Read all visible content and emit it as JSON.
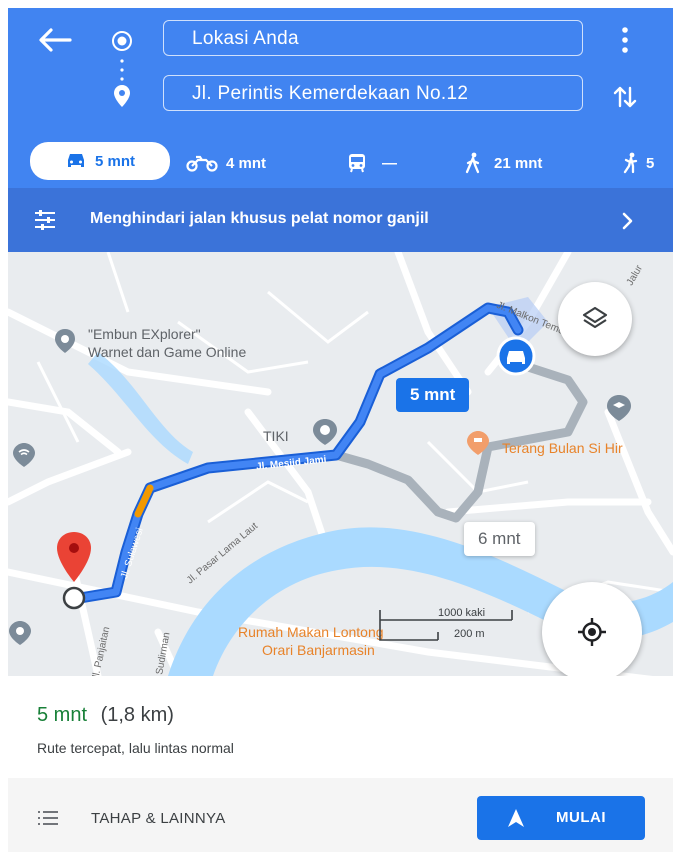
{
  "header": {
    "origin": "Lokasi Anda",
    "destination": "Jl. Perintis Kemerdekaan No.12",
    "modes": [
      {
        "name": "car",
        "label": "5 mnt"
      },
      {
        "name": "motorcycle",
        "label": "4 mnt"
      },
      {
        "name": "transit",
        "label": "—"
      },
      {
        "name": "walk",
        "label": "21 mnt"
      },
      {
        "name": "ride",
        "label": "5"
      }
    ]
  },
  "avoid_bar": {
    "text": "Menghindari jalan khusus pelat nomor ganjil"
  },
  "map": {
    "places": {
      "embun_line1": "\"Embun EXplorer\"",
      "embun_line2": "Warnet dan Game Online",
      "tiki": "TIKI",
      "terang_bulan": "Terang Bulan Si Hir",
      "rumah_makan_line1": "Rumah Makan Lontong",
      "rumah_makan_line2": "Orari Banjarmasin"
    },
    "roads": {
      "malkon_temon": "Jl. Malkon Temon",
      "mesjid_jami": "Jl. Mesjid Jami",
      "sulawesi": "Jl. Sulawesi",
      "pasar_lama_laut": "Jl. Pasar Lama Laut",
      "panjaitan": "Jl. Panjaitan",
      "sudirman": "Sudirman",
      "jalur": "Jalur"
    },
    "route_primary_time": "5 mnt",
    "route_alt_time": "6 mnt",
    "scale_ft": "1000 kaki",
    "scale_m": "200 m",
    "colors": {
      "route": "#4285f4",
      "alt_route": "#a9b2bb",
      "water": "#aadaff",
      "pin": "#ea4335"
    }
  },
  "summary": {
    "time": "5 mnt",
    "distance": "(1,8 km)",
    "description": "Rute tercepat, lalu lintas normal"
  },
  "bottom": {
    "steps_label": "TAHAP & LAINNYA",
    "start_label": "MULAI"
  }
}
